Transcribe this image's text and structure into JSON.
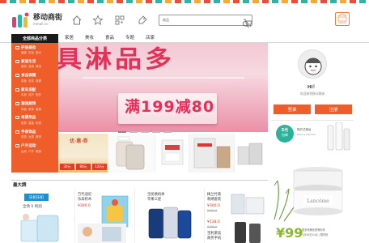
{
  "header": {
    "logo_name": "移动商街",
    "logo_sub": "mmall.cn",
    "search_label": "商品",
    "shop_badge": "iSHOP"
  },
  "nav": {
    "category_head": "全部商品分类",
    "tabs": [
      "家居",
      "美妆",
      "食品",
      "专题",
      "店家"
    ]
  },
  "categories": [
    {
      "title": "护肤美妆",
      "subs": [
        "面部",
        "彩妆",
        "香水"
      ]
    },
    {
      "title": "家居生活",
      "subs": [
        "家纺",
        "收纳",
        "清洁"
      ]
    },
    {
      "title": "食品保健",
      "subs": [
        "零食",
        "茶饮",
        "保健"
      ]
    },
    {
      "title": "家车洗配",
      "subs": [
        "车品",
        "洗护",
        "配件"
      ]
    },
    {
      "title": "潮流居饰",
      "subs": [
        "饰品",
        "家饰",
        "香薰"
      ]
    },
    {
      "title": "母婴用品",
      "subs": [
        "奶粉",
        "童装",
        "玩具"
      ]
    },
    {
      "title": "手表饰品",
      "subs": [
        "男表",
        "女表",
        "首饰"
      ]
    },
    {
      "title": "户外运动",
      "subs": [
        "运动",
        "户外",
        "健身"
      ]
    }
  ],
  "banner": {
    "headline": "具淋品多",
    "sale": "满199减80"
  },
  "promo": {
    "p1_title": "优·惠·券",
    "p1_cards": [
      "30元",
      "80元",
      "120元"
    ]
  },
  "user_panel": {
    "greeting": "HI！",
    "welcome": "欢迎来到移动商街",
    "login": "登录",
    "register": "注册",
    "coupon_amount": "5元",
    "coupon_label": "包邮",
    "ad_title": "契约式美妆",
    "ad_sub": "Nature Mention",
    "price": "¥99",
    "price_note": "更多惊爆优惠等你来",
    "price_note2": "1月30日10点 | 限时抢"
  },
  "section": {
    "title": "最大牌",
    "tag": "乐扣乐扣",
    "desc": "全场 0 利润"
  },
  "tiles": [
    {
      "title": "万代迪尼\n乐高积木",
      "price": "¥300.0",
      "old": ""
    },
    {
      "title": "全民换机季\n苹果三星",
      "price": "¥138.0",
      "old": "¥399.0"
    },
    {
      "title": "梅兰竹菊\n刺绣套装",
      "price": "¥300.0",
      "old": "¥380.0"
    },
    {
      "title": "宝利莱炫\n商务手机",
      "price": "",
      "old": ""
    }
  ],
  "colors": {
    "accent": "#ee5d2a",
    "banner_text": "#e12a51",
    "tag_blue": "#1c8fd0",
    "price_green": "#8cb82b"
  }
}
